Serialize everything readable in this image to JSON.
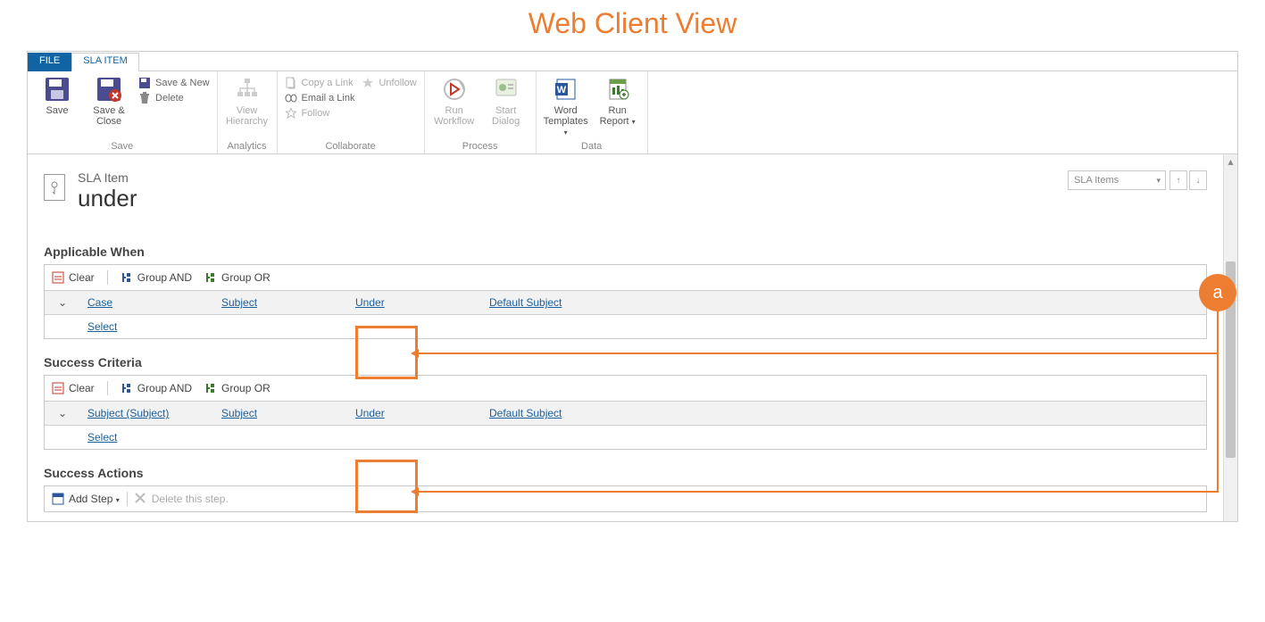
{
  "page_heading": "Web Client View",
  "tabs": {
    "file": "FILE",
    "sla_item": "SLA ITEM"
  },
  "ribbon": {
    "save": {
      "label": "Save",
      "save": "Save",
      "save_close": "Save & Close",
      "save_new": "Save & New",
      "delete": "Delete"
    },
    "analytics": {
      "label": "Analytics",
      "view_hierarchy": "View Hierarchy"
    },
    "collaborate": {
      "label": "Collaborate",
      "copy_link": "Copy a Link",
      "email_link": "Email a Link",
      "follow": "Follow",
      "unfollow": "Unfollow"
    },
    "process": {
      "label": "Process",
      "run_workflow": "Run Workflow",
      "start_dialog": "Start Dialog"
    },
    "data": {
      "label": "Data",
      "word_templates": "Word Templates",
      "run_report": "Run Report"
    }
  },
  "entity": {
    "type": "SLA Item",
    "name": "under",
    "nav_dropdown": "SLA Items"
  },
  "sections": {
    "applicable_when": {
      "heading": "Applicable When",
      "toolbar": {
        "clear": "Clear",
        "group_and": "Group AND",
        "group_or": "Group OR"
      },
      "row": {
        "entity": "Case",
        "field": "Subject",
        "operator": "Under",
        "value": "Default Subject"
      },
      "select": "Select"
    },
    "success_criteria": {
      "heading": "Success Criteria",
      "toolbar": {
        "clear": "Clear",
        "group_and": "Group AND",
        "group_or": "Group OR"
      },
      "row": {
        "entity": "Subject (Subject)",
        "field": "Subject",
        "operator": "Under",
        "value": "Default Subject"
      },
      "select": "Select"
    },
    "success_actions": {
      "heading": "Success Actions",
      "add_step": "Add Step",
      "delete_step": "Delete this step."
    }
  },
  "annotation": {
    "label": "a"
  }
}
